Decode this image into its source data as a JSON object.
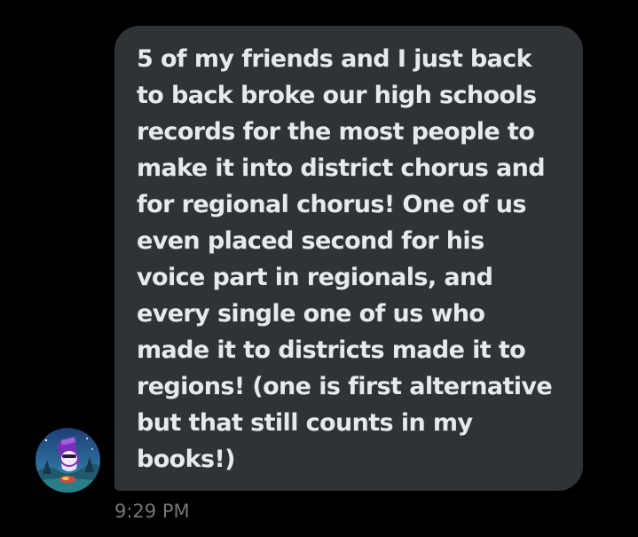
{
  "message": {
    "lines": [
      "5 of my friends and I just back",
      "to back broke our high schools",
      "records for the most people to",
      "make it into district chorus and",
      "for regional chorus! One of us",
      "even placed second for his",
      "voice part in regionals, and",
      "every single one of us who",
      "made it to districts made it to",
      "regions! (one is first alternative",
      "but that still counts in my",
      "books!)"
    ],
    "timestamp": "9:29 PM"
  },
  "sender": {
    "avatar_icon": "cartoon-character-avatar-icon"
  },
  "colors": {
    "background": "#000000",
    "bubble": "#2f3336",
    "text": "#e7e9ea",
    "timestamp": "#71767b"
  }
}
